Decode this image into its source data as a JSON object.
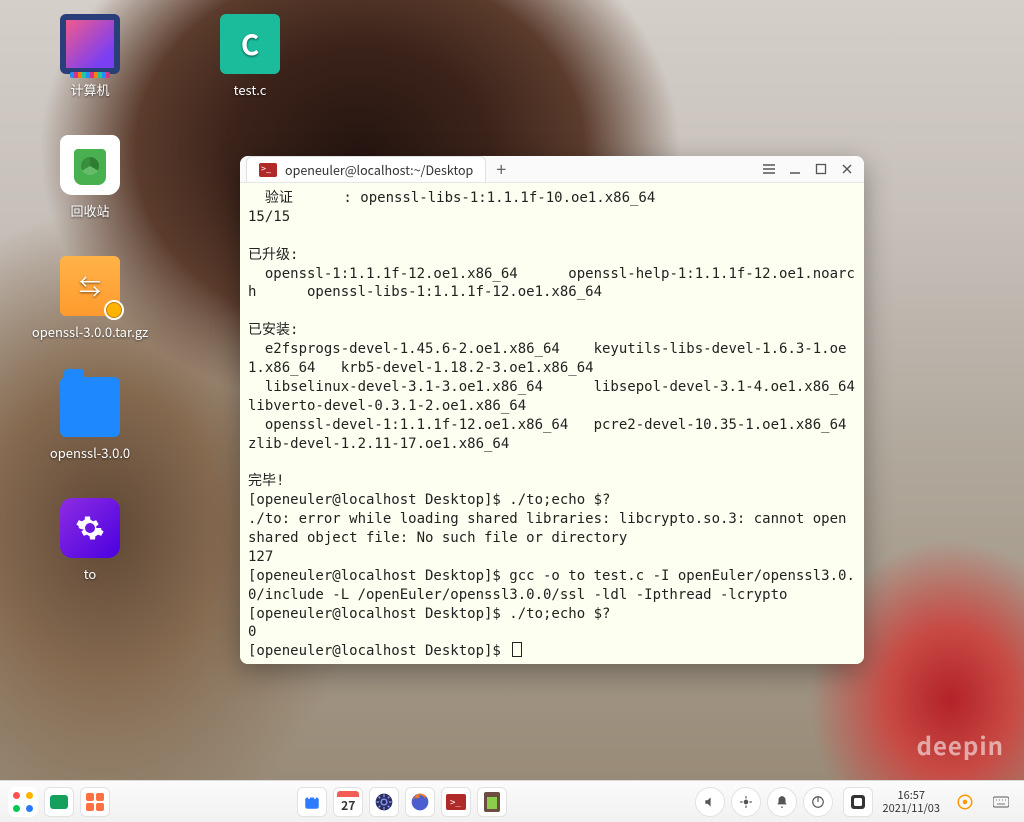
{
  "desktop": {
    "icons": [
      {
        "name": "computer",
        "label": "计算机"
      },
      {
        "name": "trash",
        "label": "回收站"
      },
      {
        "name": "openssl-tgz",
        "label": "openssl-3.0.0.tar.gz"
      },
      {
        "name": "openssl-dir",
        "label": "openssl-3.0.0"
      },
      {
        "name": "to-app",
        "label": "to"
      }
    ],
    "icons_col2": [
      {
        "name": "test-c",
        "label": "test.c",
        "badge": "C"
      }
    ],
    "wallpaper_mark": "deepin"
  },
  "terminal": {
    "tab_title": "openeuler@localhost:~/Desktop",
    "lines": [
      "  验证      : openssl-libs-1:1.1.1f-10.oe1.x86_64                         15/15",
      "",
      "已升级:",
      "  openssl-1:1.1.1f-12.oe1.x86_64      openssl-help-1:1.1.1f-12.oe1.noarch      openssl-libs-1:1.1.1f-12.oe1.x86_64",
      "",
      "已安装:",
      "  e2fsprogs-devel-1.45.6-2.oe1.x86_64    keyutils-libs-devel-1.6.3-1.oe1.x86_64   krb5-devel-1.18.2-3.oe1.x86_64",
      "  libselinux-devel-3.1-3.oe1.x86_64      libsepol-devel-3.1-4.oe1.x86_64          libverto-devel-0.3.1-2.oe1.x86_64",
      "  openssl-devel-1:1.1.1f-12.oe1.x86_64   pcre2-devel-10.35-1.oe1.x86_64           zlib-devel-1.2.11-17.oe1.x86_64",
      "",
      "完毕!",
      "[openeuler@localhost Desktop]$ ./to;echo $?",
      "./to: error while loading shared libraries: libcrypto.so.3: cannot open shared object file: No such file or directory",
      "127",
      "[openeuler@localhost Desktop]$ gcc -o to test.c -I openEuler/openssl3.0.0/include -L /openEuler/openssl3.0.0/ssl -ldl -Ipthread -lcrypto",
      "[openeuler@localhost Desktop]$ ./to;echo $?",
      "0"
    ],
    "prompt_final": "[openeuler@localhost Desktop]$ "
  },
  "taskbar": {
    "calendar_day": "27",
    "clock_time": "16:57",
    "clock_date": "2021/11/03"
  }
}
